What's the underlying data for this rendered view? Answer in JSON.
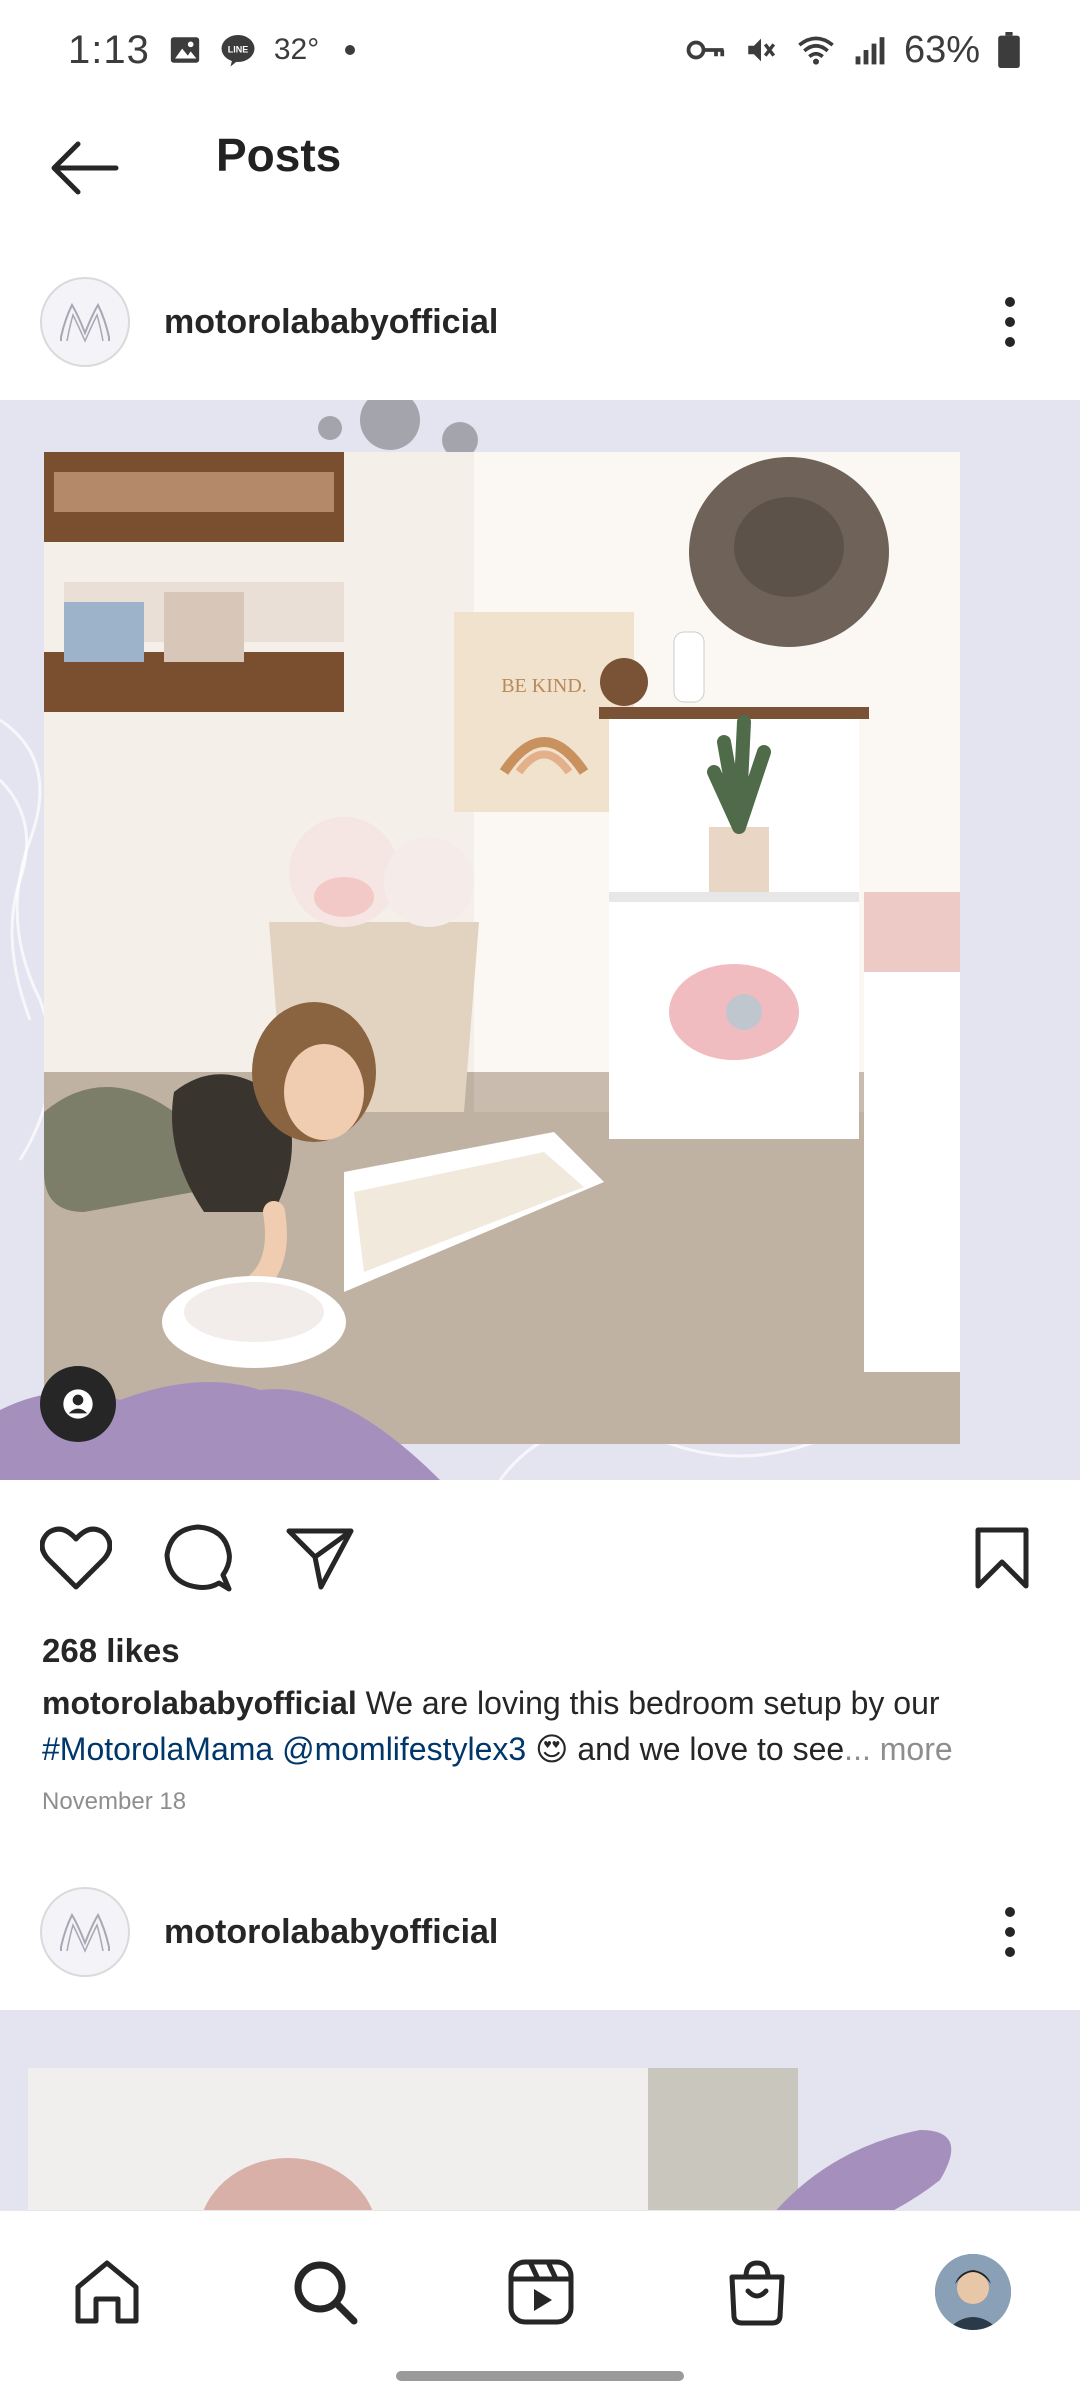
{
  "status_bar": {
    "time": "1:13",
    "temperature": "32°",
    "battery": "63%",
    "icons": [
      "gallery-icon",
      "line-app-icon",
      "vpn-key-icon",
      "mute-icon",
      "wifi-icon",
      "signal-icon",
      "battery-icon"
    ]
  },
  "header": {
    "title": "Posts",
    "back_icon": "arrow-left-icon"
  },
  "posts": [
    {
      "username": "motorolababyofficial",
      "avatar_icon": "motorola-logo-icon",
      "media_text": "BE KIND.",
      "likes": "268 likes",
      "caption": {
        "user": "motorolababyofficial",
        "text_1": " We are loving this bedroom setup by our",
        "hashtag": "#MotorolaMama",
        "mention": "@momlifestylex3",
        "emoji": "😍",
        "text_2": " and we love to see",
        "more": "... more"
      },
      "date": "November 18"
    },
    {
      "username": "motorolababyofficial",
      "avatar_icon": "motorola-logo-icon"
    }
  ],
  "actions": {
    "like_icon": "heart-icon",
    "comment_icon": "comment-icon",
    "share_icon": "send-icon",
    "save_icon": "bookmark-icon"
  },
  "bottom_nav": [
    "home-icon",
    "search-icon",
    "reels-icon",
    "shop-icon",
    "profile-avatar"
  ],
  "colors": {
    "link": "#00376b",
    "muted": "#8e8e8e",
    "media_bg": "#e4e4f0",
    "text": "#262626"
  }
}
